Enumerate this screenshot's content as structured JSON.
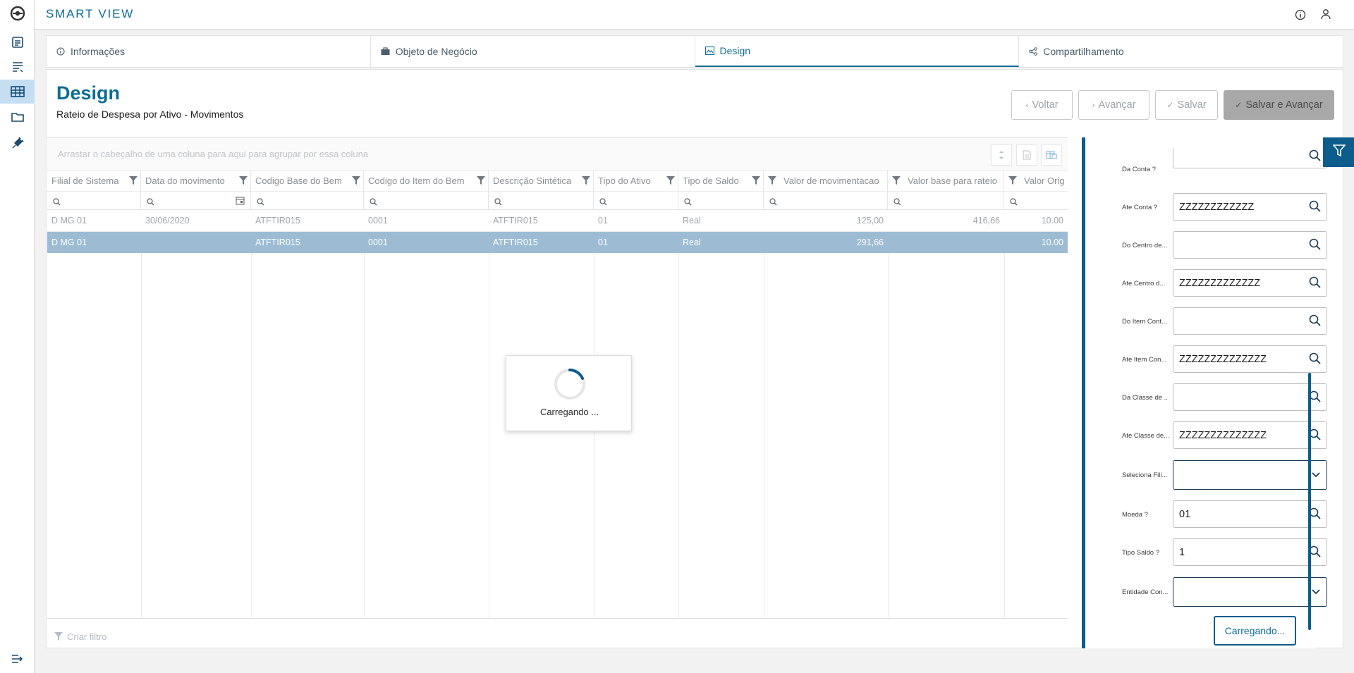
{
  "app": {
    "title": "SMART VIEW"
  },
  "sidebar": {
    "items": [
      {
        "icon": "report-icon"
      },
      {
        "icon": "report-list-icon"
      },
      {
        "icon": "table-icon",
        "active": true
      },
      {
        "icon": "folder-icon"
      },
      {
        "icon": "plug-icon"
      }
    ],
    "bottom_icon": "collapse-menu-icon"
  },
  "header": {
    "icons": [
      "info-icon",
      "user-icon"
    ]
  },
  "tabs": [
    {
      "label": "Informações",
      "icon": "info-icon"
    },
    {
      "label": "Objeto de Negócio",
      "icon": "briefcase-icon"
    },
    {
      "label": "Design",
      "icon": "image-icon",
      "active": true
    },
    {
      "label": "Compartilhamento",
      "icon": "share-icon"
    }
  ],
  "page": {
    "title": "Design",
    "subtitle": "Rateio de Despesa por Ativo - Movimentos"
  },
  "buttons": {
    "back": "Voltar",
    "next": "Avançar",
    "save": "Salvar",
    "save_next": "Salvar e Avançar"
  },
  "grid": {
    "group_hint": "Arrastar o cabeçalho de uma coluna para aqui para agrupar por essa coluna",
    "columns": [
      "Filial de Sistema",
      "Data do movimento",
      "Codigo Base do Bem",
      "Codigo do Item do Bem",
      "Descrição Sintética",
      "Tipo do Ativo",
      "Tipo de Saldo",
      "Valor de movimentacao",
      "Valor base para rateio",
      "Valor Orig"
    ],
    "rows": [
      [
        "D MG 01",
        "30/06/2020",
        "ATFTIR015",
        "0001",
        "ATFTIR015",
        "01",
        "Real",
        "125,00",
        "416,66",
        "10.00"
      ],
      [
        "D MG 01",
        "",
        "ATFTIR015",
        "0001",
        "ATFTIR015",
        "01",
        "Real",
        "291,66",
        "",
        "10.00"
      ]
    ],
    "selected_row": 1,
    "footer": "Criar filtro"
  },
  "loading": {
    "text": "Carregando ..."
  },
  "params": [
    {
      "label": "Da Conta ?",
      "value": "",
      "type": "search"
    },
    {
      "label": "Ate Conta ?",
      "value": "ZZZZZZZZZZZZ",
      "type": "search"
    },
    {
      "label": "Do Centro de...",
      "value": "",
      "type": "search"
    },
    {
      "label": "Ate Centro d...",
      "value": "ZZZZZZZZZZZZZ",
      "type": "search"
    },
    {
      "label": "Do Item Cont...",
      "value": "",
      "type": "search"
    },
    {
      "label": "Ate Item Con...",
      "value": "ZZZZZZZZZZZZZZ",
      "type": "search"
    },
    {
      "label": "Da Classe de ...",
      "value": "",
      "type": "search"
    },
    {
      "label": "Ate Classe de...",
      "value": "ZZZZZZZZZZZZZZ",
      "type": "search"
    },
    {
      "label": "Seleciona Fili...",
      "value": "",
      "type": "select"
    },
    {
      "label": "Moeda ?",
      "value": "01",
      "type": "search"
    },
    {
      "label": "Tipo Saldo ?",
      "value": "1",
      "type": "search"
    },
    {
      "label": "Entidade Con...",
      "value": "",
      "type": "select"
    }
  ],
  "param_button": "Carregando...",
  "colors": {
    "accent": "#0c6c94",
    "selected_row": "#9dbcd4",
    "panel_bar": "#0c5c8c"
  }
}
